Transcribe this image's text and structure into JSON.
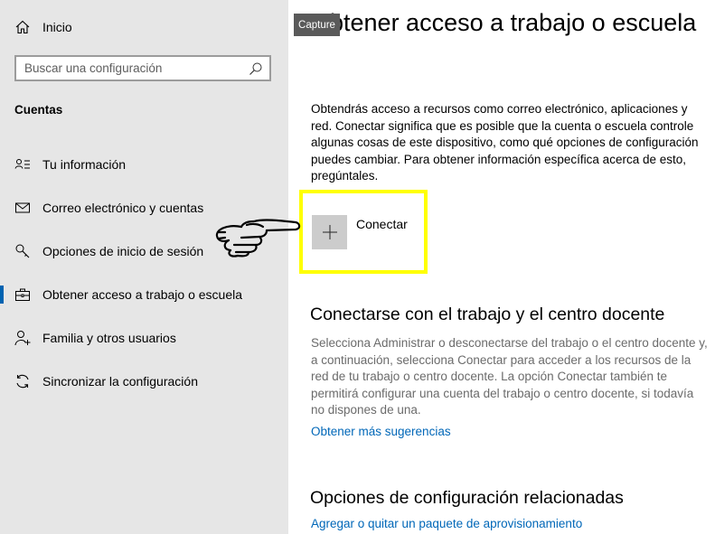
{
  "sidebar": {
    "home_label": "Inicio",
    "search_placeholder": "Buscar una configuración",
    "section_title": "Cuentas",
    "items": [
      {
        "label": "Tu información",
        "icon": "person-card-icon"
      },
      {
        "label": "Correo electrónico y cuentas",
        "icon": "mail-icon"
      },
      {
        "label": "Opciones de inicio de sesión",
        "icon": "key-icon"
      },
      {
        "label": "Obtener acceso a trabajo o escuela",
        "icon": "briefcase-icon",
        "selected": true
      },
      {
        "label": "Familia y otros usuarios",
        "icon": "add-person-icon"
      },
      {
        "label": "Sincronizar la configuración",
        "icon": "sync-icon"
      }
    ]
  },
  "main": {
    "title": "Obtener acceso a trabajo o escuela",
    "capture_badge": "Capture",
    "intro": "Obtendrás acceso a recursos como correo electrónico, aplicaciones y red. Conectar significa que es posible que la cuenta o escuela controle algunas cosas de este dispositivo, como qué opciones de configuración puedes cambiar. Para obtener información específica acerca de esto, pregúntales.",
    "connect_label": "Conectar",
    "section2_title": "Conectarse con el trabajo y el centro docente",
    "section2_desc": "Selecciona Administrar o desconectarse del trabajo o el centro docente y, a continuación, selecciona Conectar para acceder a los recursos de la red de tu trabajo o centro docente. La opción Conectar también te permitirá configurar una cuenta del trabajo o centro docente, si todavía no dispones de una.",
    "tips_link": "Obtener más sugerencias",
    "section3_title": "Opciones de configuración relacionadas",
    "provision_link": "Agregar o quitar un paquete de aprovisionamiento"
  },
  "colors": {
    "sidebar_bg": "#e6e6e6",
    "accent": "#0063b1",
    "link": "#0067b8",
    "highlight": "#ffff00",
    "button_bg": "#cccccc"
  }
}
